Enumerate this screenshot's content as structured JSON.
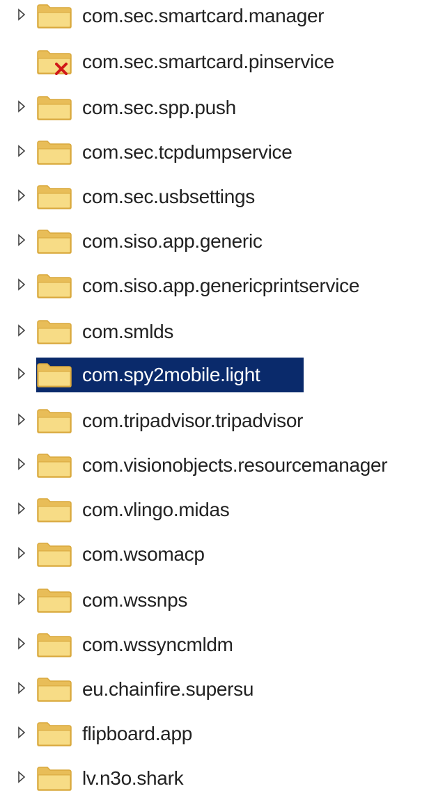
{
  "tree": {
    "items": [
      {
        "label": "com.sec.smartcard.manager",
        "expandable": true,
        "icon": "folder-icon",
        "selected": false
      },
      {
        "label": "com.sec.smartcard.pinservice",
        "expandable": false,
        "icon": "folder-error-icon",
        "selected": false
      },
      {
        "label": "com.sec.spp.push",
        "expandable": true,
        "icon": "folder-icon",
        "selected": false
      },
      {
        "label": "com.sec.tcpdumpservice",
        "expandable": true,
        "icon": "folder-icon",
        "selected": false
      },
      {
        "label": "com.sec.usbsettings",
        "expandable": true,
        "icon": "folder-icon",
        "selected": false
      },
      {
        "label": "com.siso.app.generic",
        "expandable": true,
        "icon": "folder-icon",
        "selected": false
      },
      {
        "label": "com.siso.app.genericprintservice",
        "expandable": true,
        "icon": "folder-icon",
        "selected": false
      },
      {
        "label": "com.smlds",
        "expandable": true,
        "icon": "folder-icon",
        "selected": false
      },
      {
        "label": "com.spy2mobile.light",
        "expandable": true,
        "icon": "folder-icon",
        "selected": true
      },
      {
        "label": "com.tripadvisor.tripadvisor",
        "expandable": true,
        "icon": "folder-icon",
        "selected": false
      },
      {
        "label": "com.visionobjects.resourcemanager",
        "expandable": true,
        "icon": "folder-icon",
        "selected": false
      },
      {
        "label": "com.vlingo.midas",
        "expandable": true,
        "icon": "folder-icon",
        "selected": false
      },
      {
        "label": "com.wsomacp",
        "expandable": true,
        "icon": "folder-icon",
        "selected": false
      },
      {
        "label": "com.wssnps",
        "expandable": true,
        "icon": "folder-icon",
        "selected": false
      },
      {
        "label": "com.wssyncmldm",
        "expandable": true,
        "icon": "folder-icon",
        "selected": false
      },
      {
        "label": "eu.chainfire.supersu",
        "expandable": true,
        "icon": "folder-icon",
        "selected": false
      },
      {
        "label": "flipboard.app",
        "expandable": true,
        "icon": "folder-icon",
        "selected": false
      },
      {
        "label": "lv.n3o.shark",
        "expandable": true,
        "icon": "folder-icon",
        "selected": false
      }
    ]
  },
  "colors": {
    "folder_fill": "#f7dc86",
    "folder_edge": "#d9a83c",
    "folder_tab": "#e8bd58",
    "selection": "#0a2a6b",
    "error_x": "#d01818"
  }
}
